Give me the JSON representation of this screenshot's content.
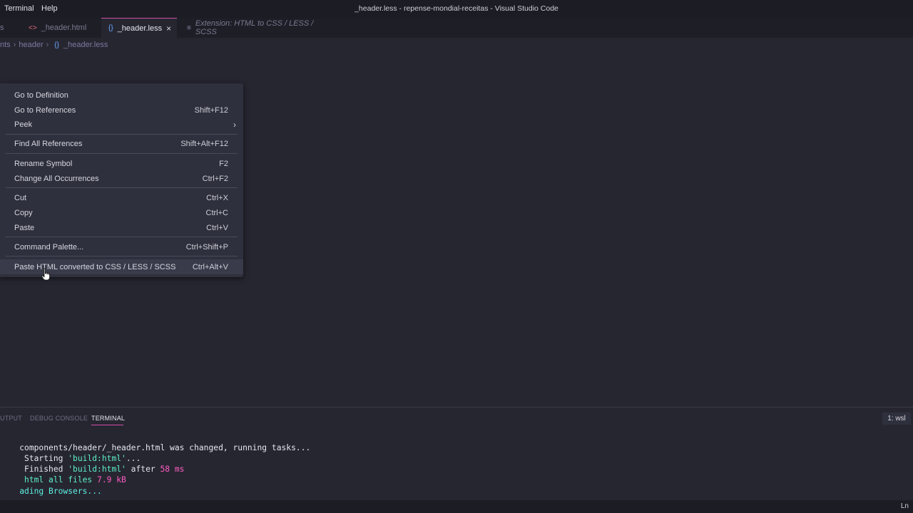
{
  "titlebar": {
    "menus": [
      "Terminal",
      "Help"
    ],
    "title": "_header.less - repense-mondial-receitas - Visual Studio Code"
  },
  "tabs": [
    {
      "label": "s",
      "icon": "",
      "active": false
    },
    {
      "label": "_header.html",
      "icon": "<>",
      "active": false
    },
    {
      "label": "_header.less",
      "icon": "{}",
      "active": true,
      "close": "×"
    },
    {
      "label": "Extension: HTML to CSS / LESS / SCSS",
      "icon": "≡",
      "active": false
    }
  ],
  "breadcrumb": {
    "items": [
      "nts",
      "header",
      "_header.less"
    ],
    "file_icon": "{}"
  },
  "context_menu": {
    "items": [
      {
        "label": "Go to Definition",
        "shortcut": ""
      },
      {
        "label": "Go to References",
        "shortcut": "Shift+F12"
      },
      {
        "label": "Peek",
        "shortcut": "",
        "submenu": "›"
      },
      {
        "label": "Find All References",
        "shortcut": "Shift+Alt+F12"
      },
      {
        "label": "Rename Symbol",
        "shortcut": "F2"
      },
      {
        "label": "Change All Occurrences",
        "shortcut": "Ctrl+F2"
      },
      {
        "label": "Cut",
        "shortcut": "Ctrl+X"
      },
      {
        "label": "Copy",
        "shortcut": "Ctrl+C"
      },
      {
        "label": "Paste",
        "shortcut": "Ctrl+V"
      },
      {
        "label": "Command Palette...",
        "shortcut": "Ctrl+Shift+P"
      },
      {
        "label": "Paste HTML converted to CSS / LESS / SCSS",
        "shortcut": "Ctrl+Alt+V"
      }
    ]
  },
  "panel": {
    "tabs": [
      "UTPUT",
      "DEBUG CONSOLE",
      "TERMINAL"
    ],
    "active_tab": "TERMINAL",
    "terminal_select": "1: wsl"
  },
  "terminal": {
    "line1": "components/header/_header.html was changed, running tasks...",
    "line2_a": " Starting ",
    "line2_b": "'build:html'",
    "line2_c": "...",
    "line3_a": " Finished ",
    "line3_b": "'build:html'",
    "line3_c": " after ",
    "line3_d": "58 ms",
    "line4_a": " html all files ",
    "line4_b": "7.9 kB",
    "line5": "ading Browsers..."
  },
  "statusbar": {
    "position": "Ln"
  },
  "colors": {
    "accent": "#d050a8",
    "editor_bg": "#262631",
    "menu_bg": "#2f303d",
    "terminal_green": "#5ef0c8",
    "terminal_pink": "#ff5cc0"
  }
}
